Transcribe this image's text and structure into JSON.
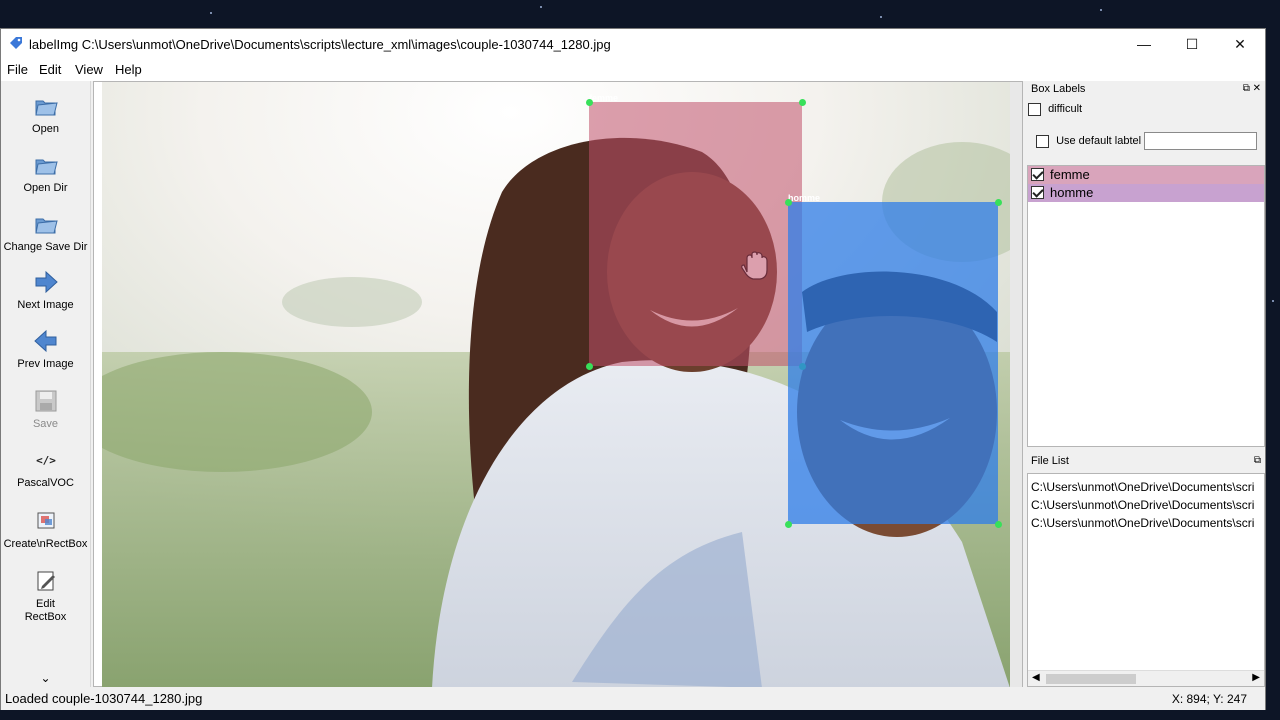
{
  "window": {
    "app_name": "labelImg",
    "file_path": "C:\\Users\\unmot\\OneDrive\\Documents\\scripts\\lecture_xml\\images\\couple-1030744_1280.jpg",
    "controls": [
      "—",
      "☐",
      "✕"
    ]
  },
  "menu": [
    "File",
    "Edit",
    "View",
    "Help"
  ],
  "toolbar": {
    "items": [
      {
        "label": "Open",
        "icon": "folder-icon",
        "enabled": true
      },
      {
        "label": "Open Dir",
        "icon": "folder-icon",
        "enabled": true
      },
      {
        "label": "Change Save Dir",
        "icon": "folder-icon",
        "enabled": true
      },
      {
        "label": "Next Image",
        "icon": "arrow-right-icon",
        "enabled": true
      },
      {
        "label": "Prev Image",
        "icon": "arrow-left-icon",
        "enabled": true
      },
      {
        "label": "Save",
        "icon": "save-icon",
        "enabled": false
      },
      {
        "label": "PascalVOC",
        "icon": "code-icon",
        "enabled": true
      },
      {
        "label": "Create\\nRectBox",
        "icon": "create-rect-icon",
        "enabled": true
      },
      {
        "label": "Edit\nRectBox",
        "icon": "edit-icon",
        "enabled": true
      }
    ],
    "more": "⌄"
  },
  "annotations": [
    {
      "label": "femme",
      "color": "#c0506a"
    },
    {
      "label": "homme",
      "color": "#2f7de8"
    }
  ],
  "box_labels_panel": {
    "title": "Box Labels",
    "difficult_label": "difficult",
    "difficult_checked": false,
    "use_default_label": "Use default labtel",
    "use_default_checked": false,
    "default_label_value": "",
    "items": [
      {
        "label": "femme",
        "checked": true,
        "bg": "#d9a4bb"
      },
      {
        "label": "homme",
        "checked": true,
        "bg": "#c8a2d0"
      }
    ]
  },
  "file_list_panel": {
    "title": "File List",
    "files": [
      "C:\\Users\\unmot\\OneDrive\\Documents\\scri",
      "C:\\Users\\unmot\\OneDrive\\Documents\\scri",
      "C:\\Users\\unmot\\OneDrive\\Documents\\scri"
    ]
  },
  "status": {
    "message": "Loaded couple-1030744_1280.jpg",
    "coords": "X: 894; Y: 247"
  },
  "colors": {
    "handle": "#38e05a",
    "femme_box": "#c0506a",
    "homme_box": "#2f7de8"
  }
}
